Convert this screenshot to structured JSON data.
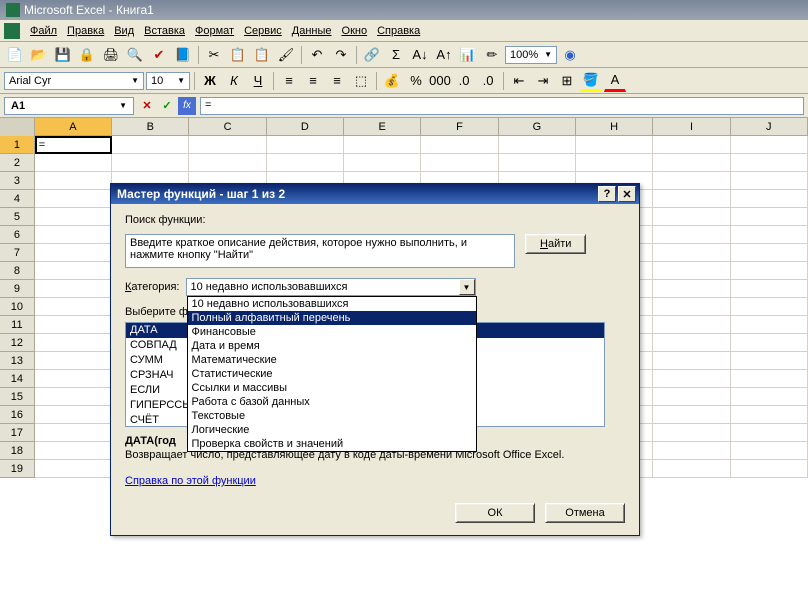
{
  "title": "Microsoft Excel - Книга1",
  "menus": [
    "Файл",
    "Правка",
    "Вид",
    "Вставка",
    "Формат",
    "Сервис",
    "Данные",
    "Окно",
    "Справка"
  ],
  "zoom": "100%",
  "font": "Arial Cyr",
  "fontsize": "10",
  "namebox": "A1",
  "formula": "=",
  "cell_a1": "=",
  "columns": [
    "A",
    "B",
    "C",
    "D",
    "E",
    "F",
    "G",
    "H",
    "I",
    "J"
  ],
  "rownums": [
    "1",
    "2",
    "3",
    "4",
    "5",
    "6",
    "7",
    "8",
    "9",
    "10",
    "11",
    "12",
    "13",
    "14",
    "15",
    "16",
    "17",
    "18",
    "19"
  ],
  "dialog": {
    "title": "Мастер функций - шаг 1 из 2",
    "search_label": "Поиск функции:",
    "search_text": "Введите краткое описание действия, которое нужно выполнить, и нажмите кнопку \"Найти\"",
    "find_btn": "Найти",
    "category_label": "Категория:",
    "category_value": "10 недавно использовавшихся",
    "select_label": "Выберите фу",
    "categories": [
      "10 недавно использовавшихся",
      "Полный алфавитный перечень",
      "Финансовые",
      "Дата и время",
      "Математические",
      "Статистические",
      "Ссылки и массивы",
      "Работа с базой данных",
      "Текстовые",
      "Логические",
      "Проверка свойств и значений"
    ],
    "category_selected_index": 1,
    "functions": [
      "ДАТА",
      "СОВПАД",
      "СУММ",
      "СРЗНАЧ",
      "ЕСЛИ",
      "ГИПЕРССЫ",
      "СЧЁТ"
    ],
    "function_selected_index": 0,
    "signature": "ДАТА(год",
    "description": "Возвращает число, представляющее дату в коде даты-времени Microsoft Office Excel.",
    "help_link": "Справка по этой функции",
    "ok": "ОК",
    "cancel": "Отмена"
  }
}
